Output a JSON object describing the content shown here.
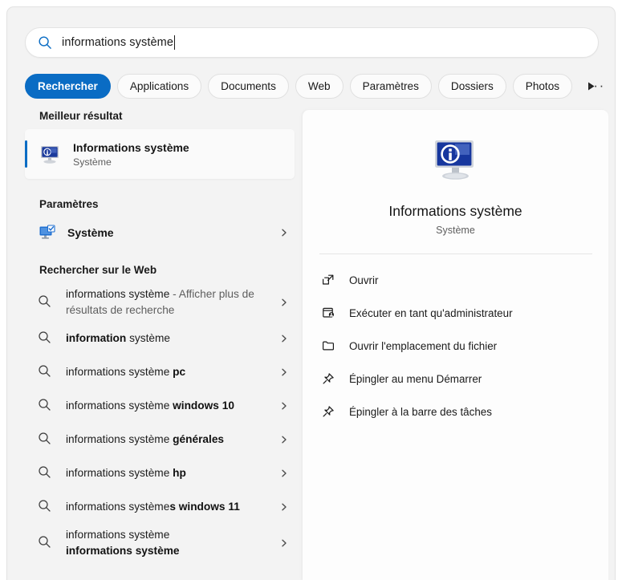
{
  "search": {
    "value": "informations système",
    "icon": "search-icon"
  },
  "tabs": [
    {
      "label": "Rechercher",
      "active": true
    },
    {
      "label": "Applications",
      "active": false
    },
    {
      "label": "Documents",
      "active": false
    },
    {
      "label": "Web",
      "active": false
    },
    {
      "label": "Paramètres",
      "active": false
    },
    {
      "label": "Dossiers",
      "active": false
    },
    {
      "label": "Photos",
      "active": false
    }
  ],
  "tab_scroll_icon": "play-right-icon",
  "more_button": {
    "label": "···",
    "icon": "ellipsis-icon"
  },
  "left": {
    "best_result_heading": "Meilleur résultat",
    "best_result": {
      "title": "Informations système",
      "subtitle": "Système",
      "icon": "system-information-icon"
    },
    "settings_heading": "Paramètres",
    "settings_items": [
      {
        "label": "Système",
        "icon": "system-settings-icon"
      }
    ],
    "web_heading": "Rechercher sur le Web",
    "web_items": [
      {
        "parts": [
          {
            "text": "informations système",
            "style": "n"
          },
          {
            "text": " - Afficher plus de résultats de recherche",
            "style": "g"
          }
        ]
      },
      {
        "parts": [
          {
            "text": "information",
            "style": "b"
          },
          {
            "text": " système",
            "style": "n"
          }
        ]
      },
      {
        "parts": [
          {
            "text": "informations système ",
            "style": "n"
          },
          {
            "text": "pc",
            "style": "b"
          }
        ]
      },
      {
        "parts": [
          {
            "text": "informations système ",
            "style": "n"
          },
          {
            "text": "windows 10",
            "style": "b"
          }
        ]
      },
      {
        "parts": [
          {
            "text": "informations système ",
            "style": "n"
          },
          {
            "text": "générales",
            "style": "b"
          }
        ]
      },
      {
        "parts": [
          {
            "text": "informations système ",
            "style": "n"
          },
          {
            "text": "hp",
            "style": "b"
          }
        ]
      },
      {
        "parts": [
          {
            "text": "informations système",
            "style": "n"
          },
          {
            "text": "s windows 11",
            "style": "b"
          }
        ]
      },
      {
        "parts": [
          {
            "text": "informations système",
            "style": "n"
          },
          {
            "text": "\n",
            "style": "br"
          },
          {
            "text": "informations système",
            "style": "b"
          }
        ]
      }
    ]
  },
  "right": {
    "app_icon": "system-information-large-icon",
    "title": "Informations système",
    "subtitle": "Système",
    "actions": [
      {
        "label": "Ouvrir",
        "icon": "open-external-icon"
      },
      {
        "label": "Exécuter en tant qu'administrateur",
        "icon": "run-as-admin-icon"
      },
      {
        "label": "Ouvrir l'emplacement du fichier",
        "icon": "folder-icon"
      },
      {
        "label": "Épingler au menu Démarrer",
        "icon": "pin-icon"
      },
      {
        "label": "Épingler à la barre des tâches",
        "icon": "pin-icon"
      }
    ]
  },
  "colors": {
    "accent": "#0a6cc4",
    "window_bg": "#f3f3f3",
    "card_bg": "#fdfdfd",
    "text": "#1a1a1a",
    "muted_text": "#5e5e5e"
  }
}
